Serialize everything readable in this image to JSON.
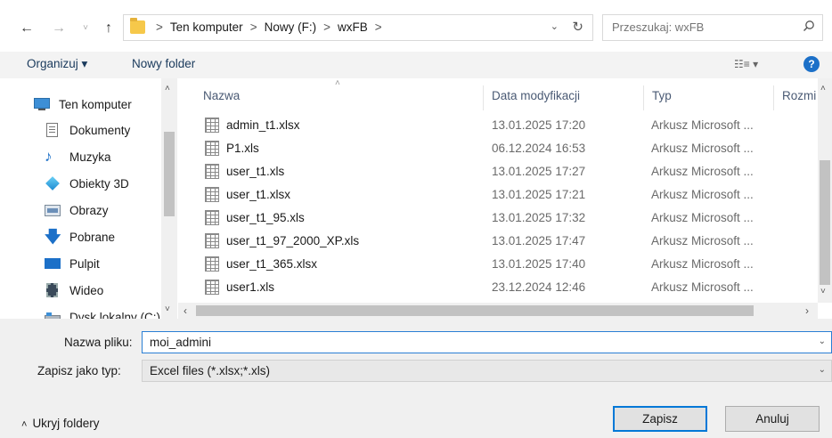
{
  "address_bar": {
    "crumbs": [
      "Ten komputer",
      "Nowy (F:)",
      "wxFB"
    ],
    "separator": ">",
    "search_placeholder": "Przeszukaj: wxFB"
  },
  "toolbar": {
    "organize_label": "Organizuj ▾",
    "new_folder_label": "Nowy folder",
    "help_label": "?"
  },
  "nav_pane": {
    "items": [
      {
        "label": "Ten komputer",
        "icon": "computer-icon"
      },
      {
        "label": "Dokumenty",
        "icon": "documents-icon"
      },
      {
        "label": "Muzyka",
        "icon": "music-icon"
      },
      {
        "label": "Obiekty 3D",
        "icon": "objects-3d-icon"
      },
      {
        "label": "Obrazy",
        "icon": "pictures-icon"
      },
      {
        "label": "Pobrane",
        "icon": "downloads-icon"
      },
      {
        "label": "Pulpit",
        "icon": "desktop-icon"
      },
      {
        "label": "Wideo",
        "icon": "video-icon"
      },
      {
        "label": "Dysk lokalny (C:)",
        "icon": "local-disk-icon"
      }
    ]
  },
  "file_list": {
    "columns": [
      "Nazwa",
      "Data modyfikacji",
      "Typ",
      "Rozmi"
    ],
    "rows": [
      {
        "name": "admin_t1.xlsx",
        "date": "13.01.2025 17:20",
        "type": "Arkusz Microsoft ..."
      },
      {
        "name": "P1.xls",
        "date": "06.12.2024 16:53",
        "type": "Arkusz Microsoft ..."
      },
      {
        "name": "user_t1.xls",
        "date": "13.01.2025 17:27",
        "type": "Arkusz Microsoft ..."
      },
      {
        "name": "user_t1.xlsx",
        "date": "13.01.2025 17:21",
        "type": "Arkusz Microsoft ..."
      },
      {
        "name": "user_t1_95.xls",
        "date": "13.01.2025 17:32",
        "type": "Arkusz Microsoft ..."
      },
      {
        "name": "user_t1_97_2000_XP.xls",
        "date": "13.01.2025 17:47",
        "type": "Arkusz Microsoft ..."
      },
      {
        "name": "user_t1_365.xlsx",
        "date": "13.01.2025 17:40",
        "type": "Arkusz Microsoft ..."
      },
      {
        "name": "user1.xls",
        "date": "23.12.2024 12:46",
        "type": "Arkusz Microsoft ..."
      }
    ]
  },
  "form": {
    "filename_label": "Nazwa pliku:",
    "filename_value": "moi_admini",
    "filetype_label": "Zapisz jako typ:",
    "filetype_value": "Excel files (*.xlsx;*.xls)",
    "hide_folders_label": "Ukryj foldery",
    "save_label": "Zapisz",
    "cancel_label": "Anuluj"
  },
  "colors": {
    "accent": "#0078d7",
    "toolbar_bg": "#f3f3f3",
    "footer_bg": "#f0f0f0"
  }
}
